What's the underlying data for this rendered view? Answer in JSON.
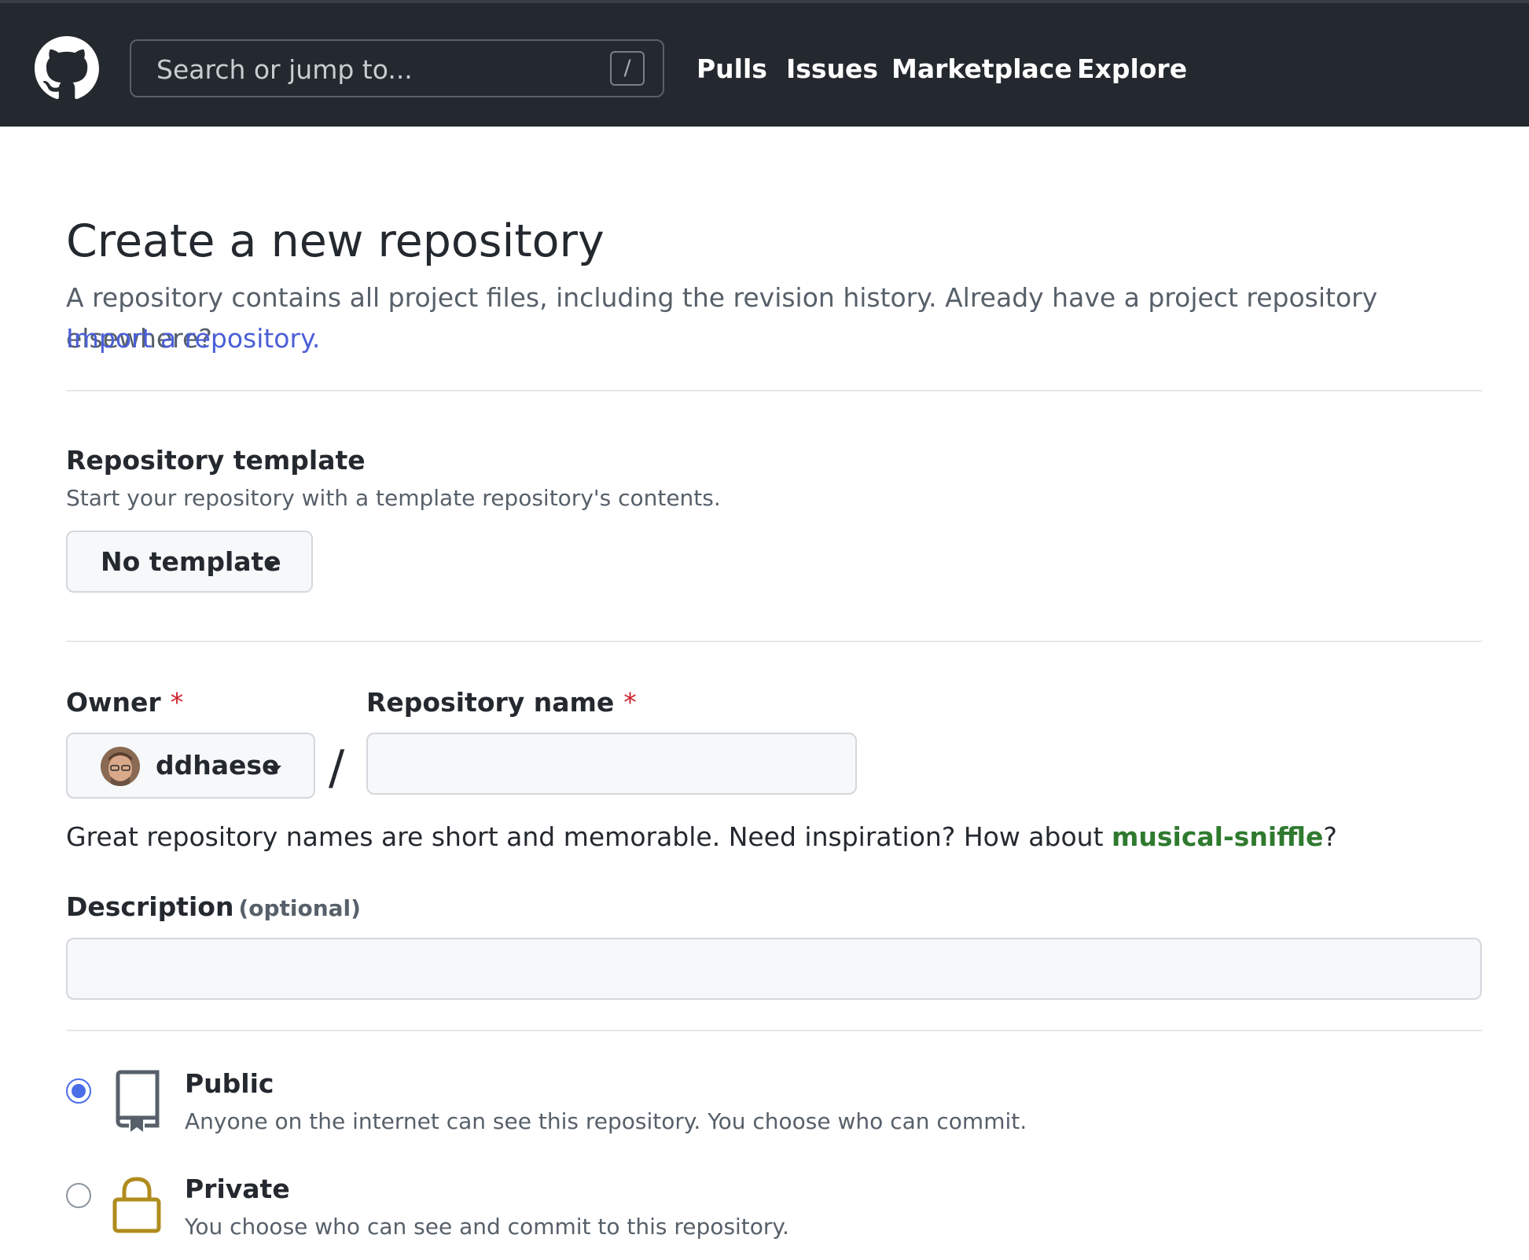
{
  "header": {
    "search_placeholder": "Search or jump to...",
    "search_shortcut": "/",
    "nav": [
      "Pulls",
      "Issues",
      "Marketplace",
      "Explore"
    ]
  },
  "page": {
    "title": "Create a new repository",
    "lead": "A repository contains all project files, including the revision history. Already have a project repository elsewhere?",
    "import_link": "Import a repository."
  },
  "template": {
    "label": "Repository template",
    "note": "Start your repository with a template repository's contents.",
    "selected": "No template"
  },
  "owner": {
    "label": "Owner",
    "required_mark": "*",
    "value": "ddhaese"
  },
  "repo_name": {
    "label": "Repository name",
    "required_mark": "*",
    "value": ""
  },
  "separator": "/",
  "hint": {
    "prefix": "Great repository names are short and memorable. Need inspiration? How about ",
    "suggestion": "musical-sniffle",
    "suffix": "?"
  },
  "description": {
    "label": "Description",
    "optional": "(optional)",
    "value": ""
  },
  "visibility": {
    "public": {
      "title": "Public",
      "desc": "Anyone on the internet can see this repository. You choose who can commit.",
      "checked": true
    },
    "private": {
      "title": "Private",
      "desc": "You choose who can see and commit to this repository.",
      "checked": false
    }
  },
  "colors": {
    "header_bg": "#24292f",
    "link": "#4b5fd6",
    "suggestion": "#2f7a2f",
    "required": "#cf222e",
    "radio_checked": "#4b6ee8",
    "lock": "#b08c1e"
  },
  "icons": {
    "logo": "github-octocat-icon",
    "public": "repo-book-icon",
    "private": "lock-icon"
  }
}
